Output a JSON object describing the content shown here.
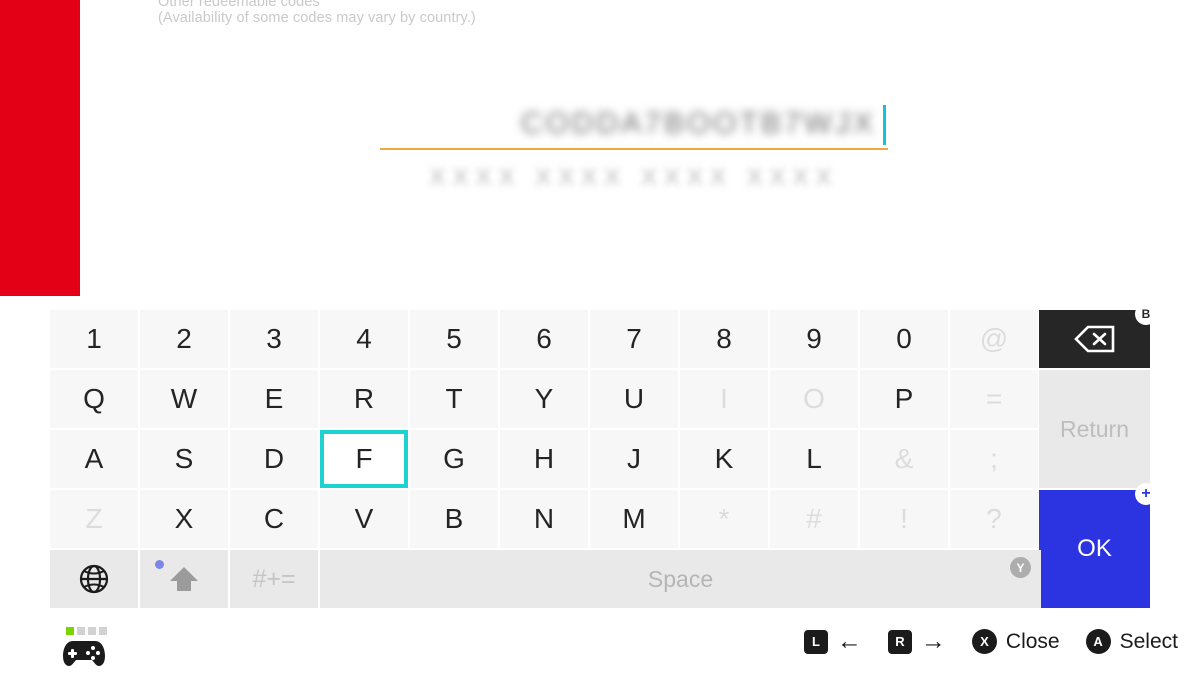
{
  "background": {
    "rail_color": "#e30017",
    "bullet_text": "Other redeemable codes",
    "availability_text": "(Availability of some codes may vary by country.)"
  },
  "code_entry": {
    "value": "CODDA7BOOTB7WJX",
    "hint": "XXXX XXXX XXXX XXXX",
    "underline_color": "#f0a742",
    "caret_color": "#15c3d6"
  },
  "keyboard": {
    "rows": [
      [
        {
          "label": "1",
          "state": "enabled"
        },
        {
          "label": "2",
          "state": "enabled"
        },
        {
          "label": "3",
          "state": "enabled"
        },
        {
          "label": "4",
          "state": "enabled"
        },
        {
          "label": "5",
          "state": "enabled"
        },
        {
          "label": "6",
          "state": "enabled"
        },
        {
          "label": "7",
          "state": "enabled"
        },
        {
          "label": "8",
          "state": "enabled"
        },
        {
          "label": "9",
          "state": "enabled"
        },
        {
          "label": "0",
          "state": "enabled"
        },
        {
          "label": "@",
          "state": "disabled"
        }
      ],
      [
        {
          "label": "Q",
          "state": "enabled"
        },
        {
          "label": "W",
          "state": "enabled"
        },
        {
          "label": "E",
          "state": "enabled"
        },
        {
          "label": "R",
          "state": "enabled"
        },
        {
          "label": "T",
          "state": "enabled"
        },
        {
          "label": "Y",
          "state": "enabled"
        },
        {
          "label": "U",
          "state": "enabled"
        },
        {
          "label": "I",
          "state": "disabled"
        },
        {
          "label": "O",
          "state": "disabled"
        },
        {
          "label": "P",
          "state": "enabled"
        },
        {
          "label": "=",
          "state": "disabled"
        }
      ],
      [
        {
          "label": "A",
          "state": "enabled"
        },
        {
          "label": "S",
          "state": "enabled"
        },
        {
          "label": "D",
          "state": "enabled"
        },
        {
          "label": "F",
          "state": "selected"
        },
        {
          "label": "G",
          "state": "enabled"
        },
        {
          "label": "H",
          "state": "enabled"
        },
        {
          "label": "J",
          "state": "enabled"
        },
        {
          "label": "K",
          "state": "enabled"
        },
        {
          "label": "L",
          "state": "enabled"
        },
        {
          "label": "&",
          "state": "disabled"
        },
        {
          "label": ";",
          "state": "disabled"
        }
      ],
      [
        {
          "label": "Z",
          "state": "disabled"
        },
        {
          "label": "X",
          "state": "enabled"
        },
        {
          "label": "C",
          "state": "enabled"
        },
        {
          "label": "V",
          "state": "enabled"
        },
        {
          "label": "B",
          "state": "enabled"
        },
        {
          "label": "N",
          "state": "enabled"
        },
        {
          "label": "M",
          "state": "enabled"
        },
        {
          "label": "*",
          "state": "disabled"
        },
        {
          "label": "#",
          "state": "disabled"
        },
        {
          "label": "!",
          "state": "disabled"
        },
        {
          "label": "?",
          "state": "disabled"
        }
      ]
    ],
    "selected_key": "F",
    "selection_color": "#1fd2cf",
    "backspace": {
      "icon": "backspace-icon",
      "badge": "B",
      "bg_color": "#262626"
    },
    "return": {
      "label": "Return",
      "state": "disabled"
    },
    "ok": {
      "label": "OK",
      "badge": "+",
      "bg_color": "#2c33e0"
    },
    "bottom_row": {
      "language": {
        "icon": "globe-icon"
      },
      "shift": {
        "icon": "shift-arrow-icon",
        "indicator": "on"
      },
      "symbols": {
        "label": "#+=",
        "state": "disabled"
      },
      "space": {
        "label": "Space",
        "badge": "Y",
        "state": "disabled"
      }
    }
  },
  "footer": {
    "controller": {
      "icon": "pro-controller-icon",
      "player_leds": [
        "on",
        "off",
        "off",
        "off"
      ],
      "led_on_color": "#7ad400"
    },
    "hints": [
      {
        "button": "L",
        "shape": "square",
        "label": "←"
      },
      {
        "button": "R",
        "shape": "square",
        "label": "→"
      },
      {
        "button": "X",
        "shape": "circle",
        "label": "Close"
      },
      {
        "button": "A",
        "shape": "circle",
        "label": "Select"
      }
    ]
  }
}
